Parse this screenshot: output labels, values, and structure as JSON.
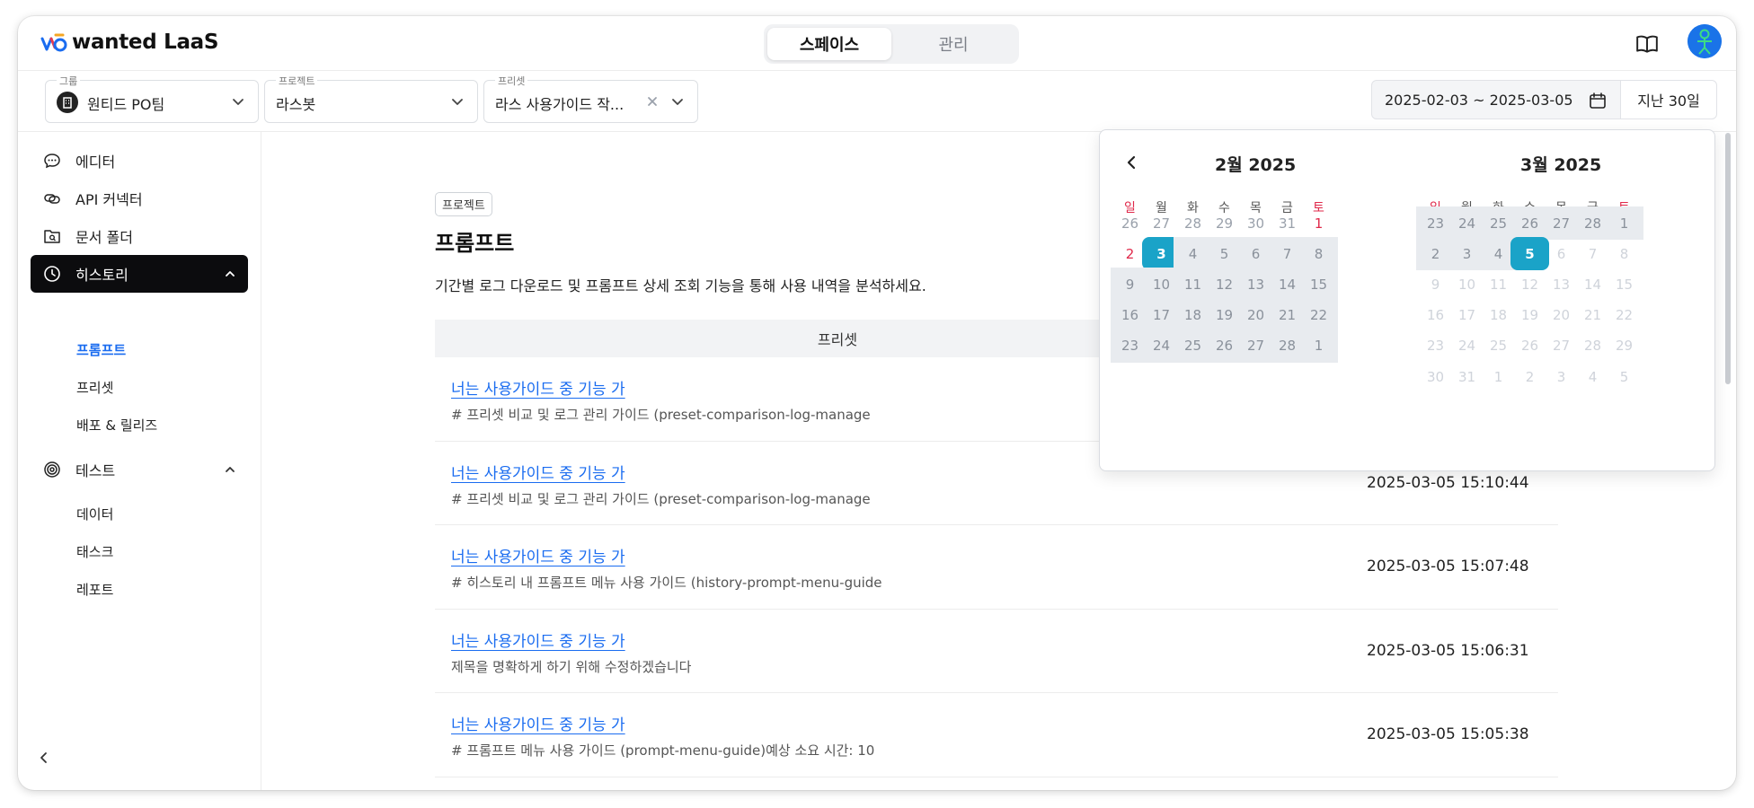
{
  "app": {
    "brand": "wanted LaaS"
  },
  "topnav": {
    "tabs": [
      {
        "label": "스페이스",
        "active": true
      },
      {
        "label": "관리",
        "active": false
      }
    ]
  },
  "filters": {
    "group": {
      "label": "그룹",
      "value": "원티드 PO팀"
    },
    "project": {
      "label": "프로젝트",
      "value": "라스봇"
    },
    "preset": {
      "label": "프리셋",
      "value": "라스 사용가이드 작..."
    },
    "date_range": "2025-02-03 ~ 2025-03-05",
    "quick_range": "지난 30일"
  },
  "sidebar": {
    "items": [
      {
        "label": "에디터",
        "icon": "chat-bubble-icon"
      },
      {
        "label": "API 커넥터",
        "icon": "link-icon"
      },
      {
        "label": "문서 폴더",
        "icon": "folder-search-icon"
      },
      {
        "label": "히스토리",
        "icon": "clock-icon",
        "active": true
      },
      {
        "label": "테스트",
        "icon": "target-icon"
      }
    ],
    "history_sub": [
      {
        "label": "프롬프트",
        "active": true
      },
      {
        "label": "프리셋"
      },
      {
        "label": "배포 & 릴리즈"
      }
    ],
    "test_sub": [
      {
        "label": "데이터"
      },
      {
        "label": "태스크"
      },
      {
        "label": "레포트"
      }
    ]
  },
  "main": {
    "tag": "프로젝트",
    "title": "프롬프트",
    "description": "기간별 로그 다운로드 및 프롬프트 상세 조회 기능을 통해 사용 내역을 분석하세요.",
    "table_header": {
      "preset": "프리셋"
    },
    "rows": [
      {
        "title": "너는 사용가이드 중 기능 가",
        "subtitle": "# 프리셋 비교 및 로그 관리 가이드 (preset-comparison-log-manage",
        "time": ""
      },
      {
        "title": "너는 사용가이드 중 기능 가",
        "subtitle": "# 프리셋 비교 및 로그 관리 가이드 (preset-comparison-log-manage",
        "time": "2025-03-05 15:10:44"
      },
      {
        "title": "너는 사용가이드 중 기능 가",
        "subtitle": "# 히스토리 내 프롬프트 메뉴 사용 가이드 (history-prompt-menu-guide",
        "time": "2025-03-05 15:07:48"
      },
      {
        "title": "너는 사용가이드 중 기능 가",
        "subtitle": "제목을 명확하게 하기 위해 수정하겠습니다",
        "time": "2025-03-05 15:06:31"
      },
      {
        "title": "너는 사용가이드 중 기능 가",
        "subtitle": "# 프롬프트 메뉴 사용 가이드 (prompt-menu-guide)예상 소요 시간: 10",
        "time": "2025-03-05 15:05:38"
      }
    ]
  },
  "calendar": {
    "weekdays": [
      "일",
      "월",
      "화",
      "수",
      "목",
      "금",
      "토"
    ],
    "months": [
      {
        "title": "2월 2025",
        "weeks": [
          [
            "26",
            "27",
            "28",
            "29",
            "30",
            "31",
            "1"
          ],
          [
            "2",
            "3",
            "4",
            "5",
            "6",
            "7",
            "8"
          ],
          [
            "9",
            "10",
            "11",
            "12",
            "13",
            "14",
            "15"
          ],
          [
            "16",
            "17",
            "18",
            "19",
            "20",
            "21",
            "22"
          ],
          [
            "23",
            "24",
            "25",
            "26",
            "27",
            "28",
            "1"
          ]
        ]
      },
      {
        "title": "3월 2025",
        "weeks": [
          [
            "23",
            "24",
            "25",
            "26",
            "27",
            "28",
            "1"
          ],
          [
            "2",
            "3",
            "4",
            "5",
            "6",
            "7",
            "8"
          ],
          [
            "9",
            "10",
            "11",
            "12",
            "13",
            "14",
            "15"
          ],
          [
            "16",
            "17",
            "18",
            "19",
            "20",
            "21",
            "22"
          ],
          [
            "23",
            "24",
            "25",
            "26",
            "27",
            "28",
            "29"
          ],
          [
            "30",
            "31",
            "1",
            "2",
            "3",
            "4",
            "5"
          ]
        ]
      }
    ],
    "selected_start": "2025-02-03",
    "selected_end": "2025-03-05"
  },
  "colors": {
    "accent": "#1a6cf0",
    "selected_day": "#1aa3c8",
    "weekend_red": "#e0294a",
    "active_nav": "#0c0c0e"
  }
}
